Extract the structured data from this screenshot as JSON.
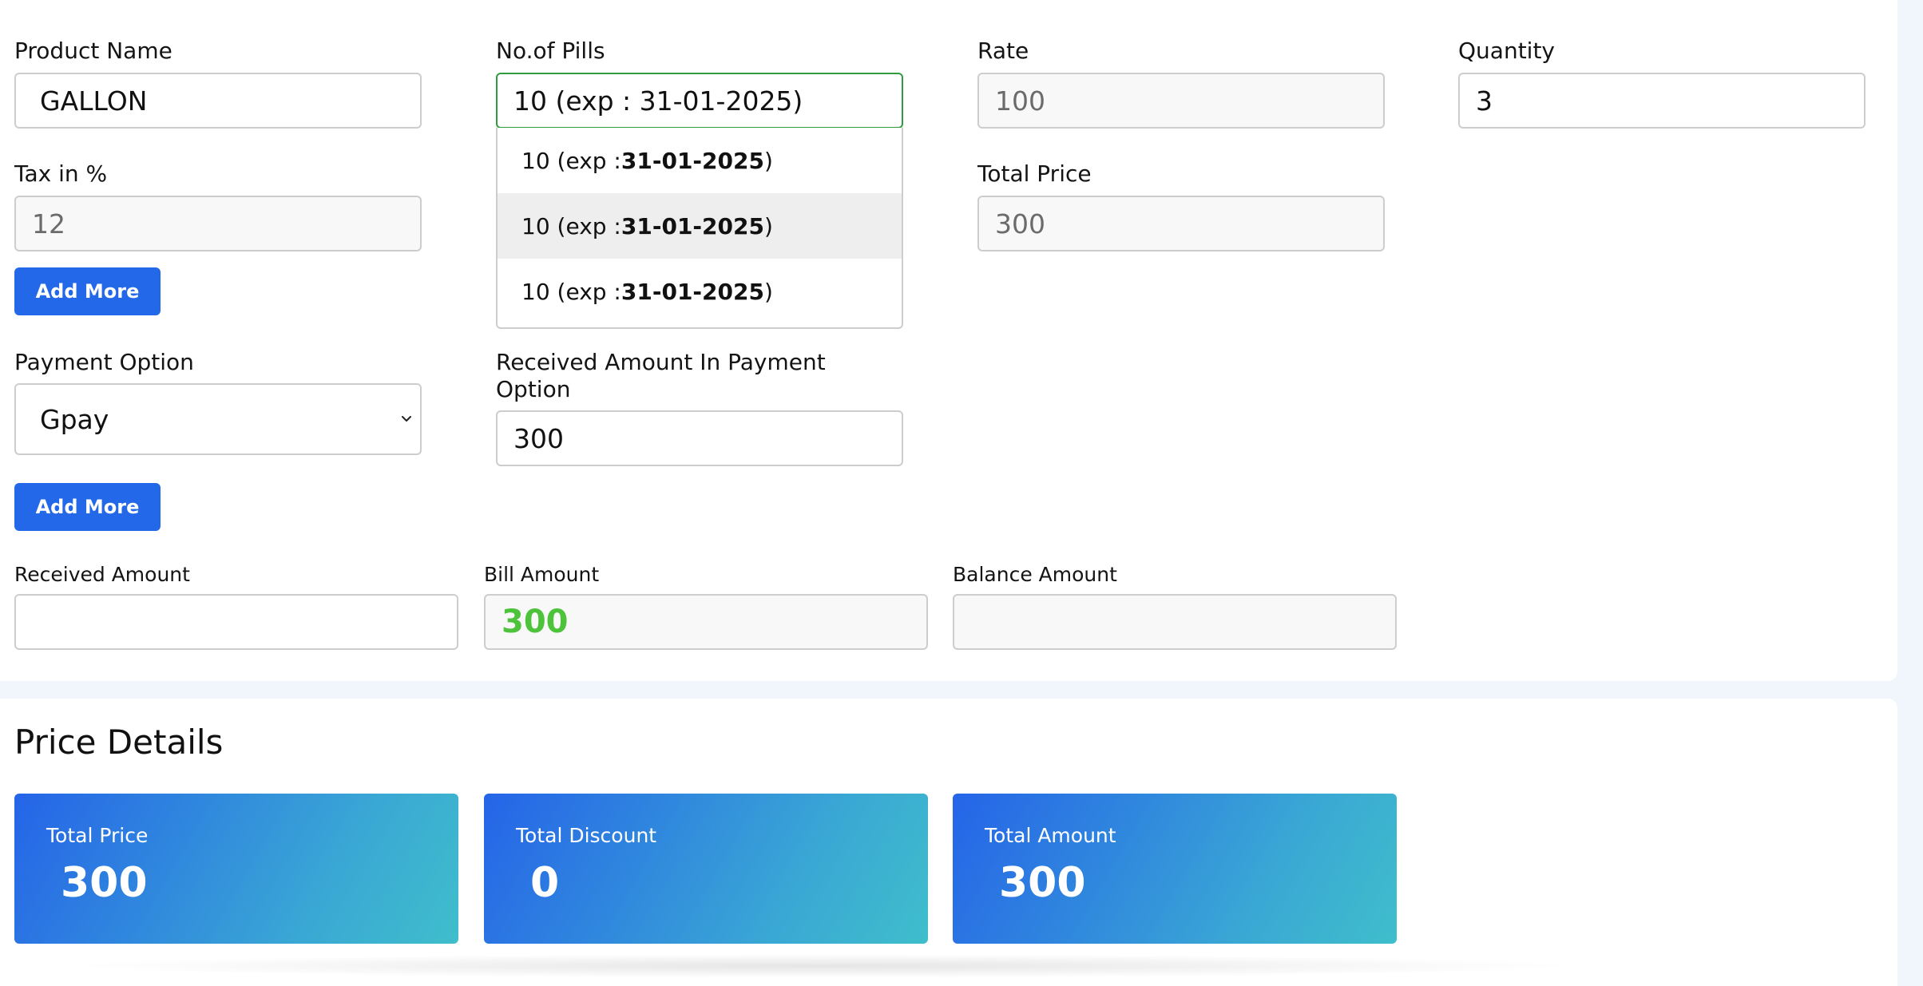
{
  "form": {
    "product_name": {
      "label": "Product Name",
      "value": "GALLON"
    },
    "pills": {
      "label": "No.of Pills",
      "value": "10  (exp : 31-01-2025)",
      "options": [
        {
          "count": "10 (exp : ",
          "date": "31-01-2025",
          "close": ")"
        },
        {
          "count": "10 (exp : ",
          "date": "31-01-2025",
          "close": ")"
        },
        {
          "count": "10 (exp : ",
          "date": "31-01-2025",
          "close": ")"
        }
      ]
    },
    "rate": {
      "label": "Rate",
      "value": "100"
    },
    "quantity": {
      "label": "Quantity",
      "value": "3"
    },
    "tax": {
      "label": "Tax in %",
      "value": "12"
    },
    "total_price": {
      "label": "Total Price",
      "value": "300"
    },
    "add_more_label": "Add More",
    "payment_option": {
      "label": "Payment Option",
      "value": "Gpay"
    },
    "received_in_payment": {
      "label": "Received Amount In Payment Option",
      "value": "300"
    },
    "add_more_label_2": "Add More",
    "received_amount": {
      "label": "Received Amount",
      "value": ""
    },
    "bill_amount": {
      "label": "Bill Amount",
      "value": "300"
    },
    "balance_amount": {
      "label": "Balance Amount",
      "value": ""
    }
  },
  "price_details": {
    "title": "Price Details",
    "cards": [
      {
        "label": "Total Price",
        "value": "300"
      },
      {
        "label": "Total Discount",
        "value": "0"
      },
      {
        "label": "Total Amount",
        "value": "300"
      }
    ]
  },
  "colors": {
    "primary": "#2368e8",
    "success_text": "#4cc33a",
    "focus_border": "#2f9c3d"
  }
}
